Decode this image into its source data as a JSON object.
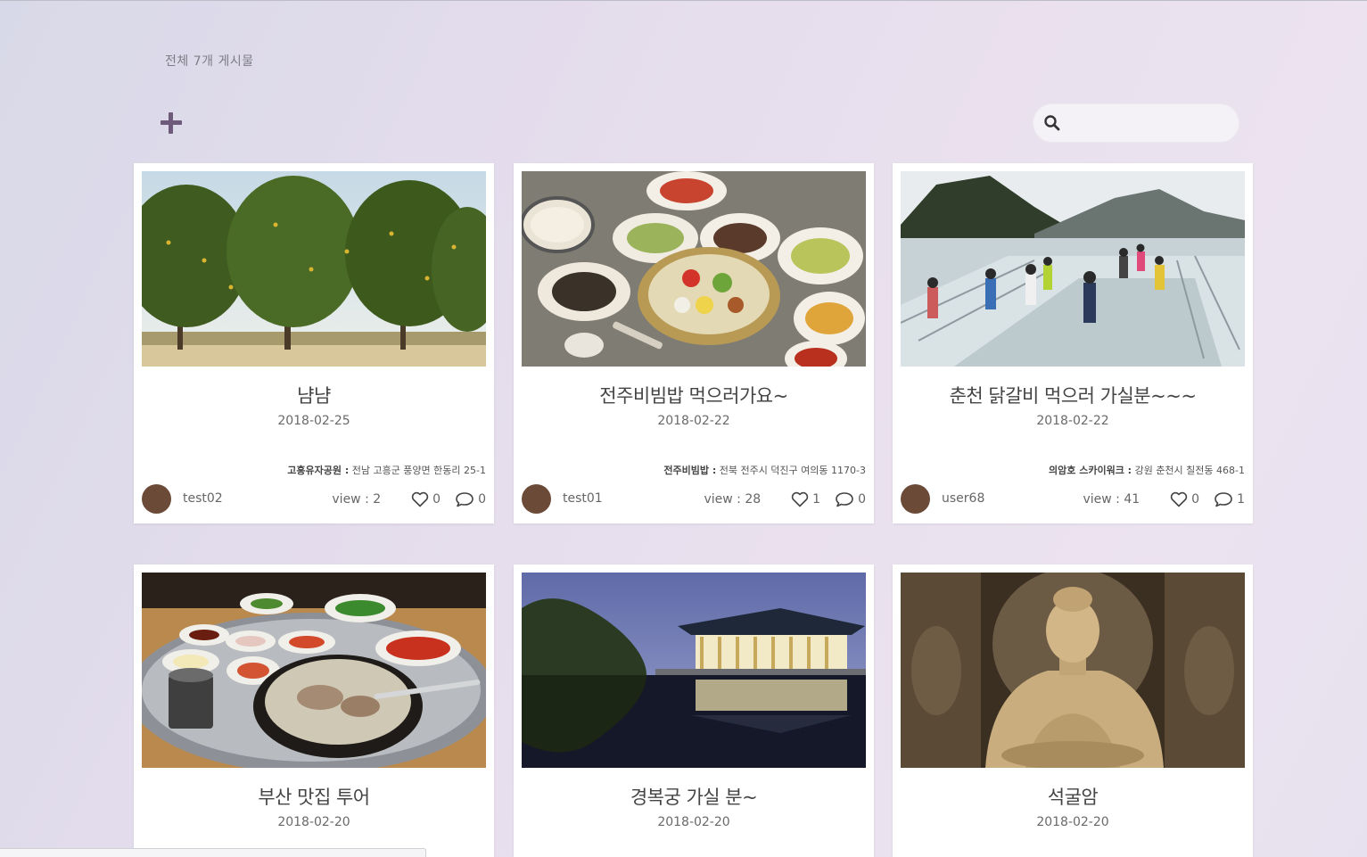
{
  "header": {
    "total_count": "전체 7개 게시물"
  },
  "search": {
    "placeholder": ""
  },
  "posts": [
    {
      "title": "냠냠",
      "date": "2018-02-25",
      "location_name": "고흥유자공원 :",
      "location_address": "전남 고흥군 풍양면 한동리 25-1",
      "user": "test02",
      "views": "view : 2",
      "likes": "0",
      "comments": "0",
      "image": "trees"
    },
    {
      "title": "전주비빔밥 먹으러가요~",
      "date": "2018-02-22",
      "location_name": "전주비빔밥 :",
      "location_address": "전북 전주시 덕진구 여의동 1170-3",
      "user": "test01",
      "views": "view : 28",
      "likes": "1",
      "comments": "0",
      "image": "bibimbap"
    },
    {
      "title": "춘천 닭갈비 먹으러 가실분~~~",
      "date": "2018-02-22",
      "location_name": "의암호 스카이워크 :",
      "location_address": "강원 춘천시 칠전동 468-1",
      "user": "user68",
      "views": "view : 41",
      "likes": "0",
      "comments": "1",
      "image": "skywalk"
    },
    {
      "title": "부산 맛집 투어",
      "date": "2018-02-20",
      "image": "soup"
    },
    {
      "title": "경복궁 가실 분~",
      "date": "2018-02-20",
      "image": "palace"
    },
    {
      "title": "석굴암",
      "date": "2018-02-20",
      "image": "buddha"
    }
  ],
  "colors": {
    "accent": "#6e5a7a",
    "avatar": "#6b4a38",
    "card_bg": "#ffffff"
  },
  "icons": {
    "add": "plus-icon",
    "search": "search-icon",
    "like": "heart-icon",
    "comment": "comment-icon"
  }
}
